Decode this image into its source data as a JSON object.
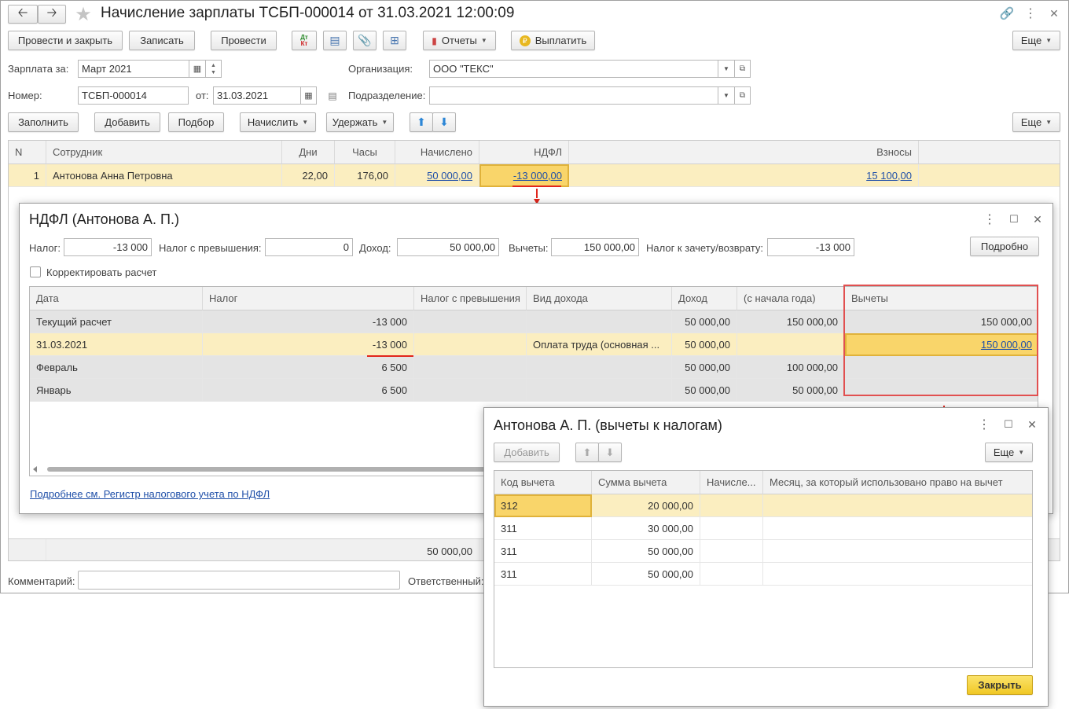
{
  "main": {
    "title": "Начисление зарплаты ТСБП-000014 от 31.03.2021 12:00:09",
    "toolbar": {
      "post_close": "Провести и закрыть",
      "save": "Записать",
      "post": "Провести",
      "dtkt": "Дт\nКт",
      "reports": "Отчеты",
      "pay": "Выплатить",
      "more": "Еще"
    },
    "salary_for_label": "Зарплата за:",
    "salary_for_value": "Март 2021",
    "org_label": "Организация:",
    "org_value": "ООО \"ТЕКС\"",
    "number_label": "Номер:",
    "number_value": "ТСБП-000014",
    "from_label": "от:",
    "date_value": "31.03.2021",
    "division_label": "Подразделение:",
    "division_value": "",
    "toolbar2": {
      "fill": "Заполнить",
      "add": "Добавить",
      "pick": "Подбор",
      "accrue": "Начислить",
      "withhold": "Удержать",
      "more": "Еще"
    },
    "table": {
      "headers": [
        "N",
        "Сотрудник",
        "Дни",
        "Часы",
        "Начислено",
        "НДФЛ",
        "Взносы"
      ],
      "rows": [
        {
          "n": "1",
          "employee": "Антонова Анна Петровна",
          "days": "22,00",
          "hours": "176,00",
          "accrued": "50 000,00",
          "ndfl": "-13 000,00",
          "contrib": "15 100,00"
        }
      ],
      "footer_accrued": "50 000,00"
    },
    "comment_label": "Комментарий:",
    "comment_value": "",
    "responsible_label": "Ответственный:"
  },
  "ndfl": {
    "title": "НДФЛ (Антонова А. П.)",
    "tax_label": "Налог:",
    "tax_value": "-13 000",
    "excess_label": "Налог с превышения:",
    "excess_value": "0",
    "income_label": "Доход:",
    "income_value": "50 000,00",
    "deductions_label": "Вычеты:",
    "deductions_value": "150 000,00",
    "offset_label": "Налог к зачету/возврату:",
    "offset_value": "-13 000",
    "details_button": "Подробно",
    "correct_label": "Корректировать расчет",
    "headers": [
      "Дата",
      "Налог",
      "Налог с превышения",
      "Вид дохода",
      "Доход",
      "(с начала года)",
      "Вычеты"
    ],
    "rows": [
      {
        "date": "Текущий расчет",
        "tax": "-13 000",
        "excess": "",
        "kind": "",
        "income": "50 000,00",
        "ytd": "150 000,00",
        "ded": "150 000,00"
      },
      {
        "date": "31.03.2021",
        "tax": "-13 000",
        "excess": "",
        "kind": "Оплата труда (основная ...",
        "income": "50 000,00",
        "ytd": "",
        "ded": "150 000,00"
      },
      {
        "date": "Февраль",
        "tax": "6 500",
        "excess": "",
        "kind": "",
        "income": "50 000,00",
        "ytd": "100 000,00",
        "ded": ""
      },
      {
        "date": "Январь",
        "tax": "6 500",
        "excess": "",
        "kind": "",
        "income": "50 000,00",
        "ytd": "50 000,00",
        "ded": ""
      }
    ],
    "register_link": "Подробнее см. Регистр налогового учета по НДФЛ"
  },
  "deductions": {
    "title": "Антонова А. П. (вычеты к налогам)",
    "add": "Добавить",
    "more": "Еще",
    "headers": [
      "Код вычета",
      "Сумма вычета",
      "Начисле...",
      "Месяц, за который использовано право на вычет"
    ],
    "rows": [
      {
        "code": "312",
        "sum": "20 000,00"
      },
      {
        "code": "311",
        "sum": "30 000,00"
      },
      {
        "code": "311",
        "sum": "50 000,00"
      },
      {
        "code": "311",
        "sum": "50 000,00"
      }
    ],
    "close": "Закрыть"
  }
}
